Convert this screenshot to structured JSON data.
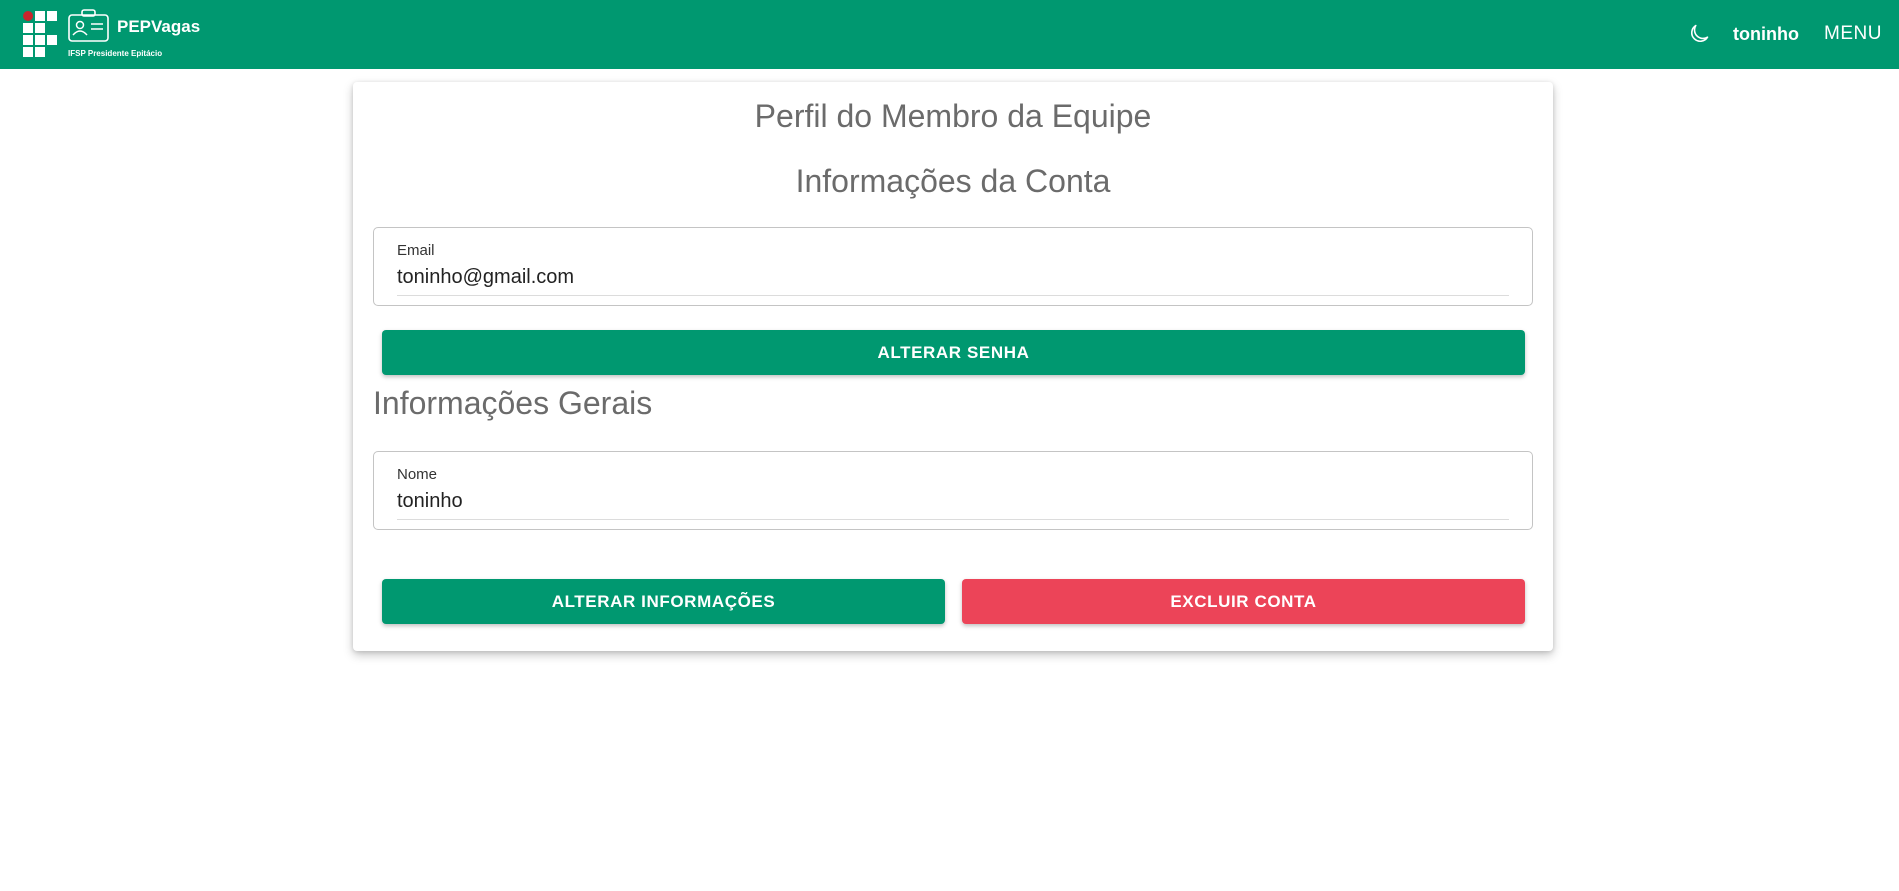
{
  "header": {
    "app_name": "PEPVagas",
    "institution": "IFSP Presidente Epitácio",
    "user": "toninho",
    "menu_label": "MENU",
    "theme_icon": "moon-icon",
    "logo_icon": "ifsp-logo-icon",
    "badge_icon": "id-badge-icon",
    "color_primary": "#009870",
    "color_logo_dot": "#c9252c"
  },
  "profile": {
    "title": "Perfil do Membro da Equipe",
    "account_heading": "Informações da Conta",
    "email_label": "Email",
    "email_value": "toninho@gmail.com",
    "change_password_label": "ALTERAR SENHA",
    "general_heading": "Informações Gerais",
    "name_label": "Nome",
    "name_value": "toninho",
    "update_info_label": "ALTERAR INFORMAÇÕES",
    "delete_account_label": "EXCLUIR CONTA",
    "color_delete": "#ec4458"
  }
}
